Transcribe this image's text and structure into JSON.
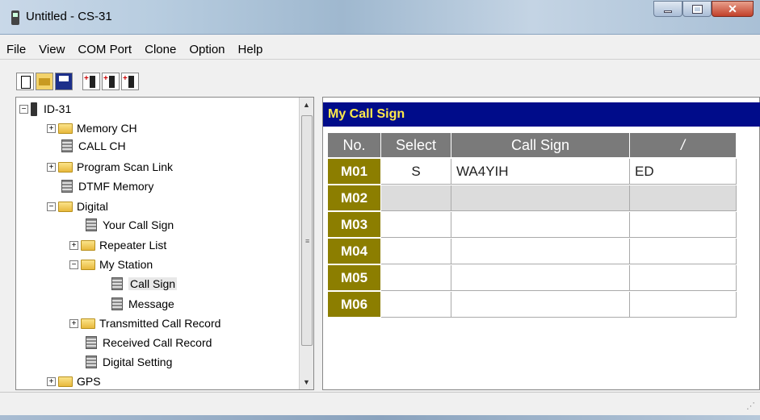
{
  "window": {
    "title": "Untitled - CS-31"
  },
  "menubar": {
    "items": [
      "File",
      "View",
      "COM Port",
      "Clone",
      "Option",
      "Help"
    ]
  },
  "tree": {
    "items": [
      {
        "label": "ID-31"
      },
      {
        "label": "Memory CH"
      },
      {
        "label": "CALL CH"
      },
      {
        "label": "Program Scan Link"
      },
      {
        "label": "DTMF Memory"
      },
      {
        "label": "Digital"
      },
      {
        "label": "Your Call Sign"
      },
      {
        "label": "Repeater List"
      },
      {
        "label": "My Station"
      },
      {
        "label": "Call Sign"
      },
      {
        "label": "Message"
      },
      {
        "label": "Transmitted Call Record"
      },
      {
        "label": "Received Call Record"
      },
      {
        "label": "Digital Setting"
      },
      {
        "label": "GPS"
      }
    ]
  },
  "panel": {
    "title": "My Call Sign",
    "columns": [
      "No.",
      "Select",
      "Call Sign",
      "/"
    ],
    "rows": [
      {
        "no": "M01",
        "select": "S",
        "call_sign": "WA4YIH",
        "suffix": "ED"
      },
      {
        "no": "M02",
        "select": "",
        "call_sign": "",
        "suffix": ""
      },
      {
        "no": "M03",
        "select": "",
        "call_sign": "",
        "suffix": ""
      },
      {
        "no": "M04",
        "select": "",
        "call_sign": "",
        "suffix": ""
      },
      {
        "no": "M05",
        "select": "",
        "call_sign": "",
        "suffix": ""
      },
      {
        "no": "M06",
        "select": "",
        "call_sign": "",
        "suffix": ""
      }
    ]
  },
  "colors": {
    "header_blue": "#000c8a",
    "header_text": "#ffe94a",
    "row_head": "#8c7e00",
    "col_head": "#7a7a7a"
  },
  "icons": [
    "new-file-icon",
    "open-folder-icon",
    "save-icon",
    "read-from-radio-icon",
    "write-to-radio-icon",
    "clone-radio-icon"
  ]
}
